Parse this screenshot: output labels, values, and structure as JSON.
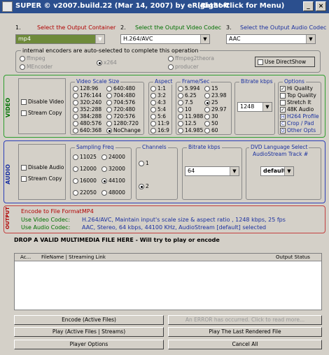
{
  "window": {
    "title": "SUPER © v2007.build.22 (Mar 14, 2007) by eRightSoft",
    "context_hint": "(Right-Click for Menu)",
    "minimize_glyph": "_",
    "close_glyph": "×"
  },
  "steps": {
    "s1_num": "1.",
    "s1_label": "Select the Output Container",
    "s2_num": "2.",
    "s2_label": "Select the Output Video Codec",
    "s3_num": "3.",
    "s3_label": "Select the Output Audio Codec"
  },
  "selects": {
    "container": "mp4",
    "video_codec": "H.264/AVC",
    "audio_codec": "AAC"
  },
  "encoders": {
    "label": "internal encoders are auto-selected to complete this operation",
    "items": [
      "ffmpeg",
      "x264",
      "ffmpeg2theora",
      "MEncoder",
      "producer"
    ],
    "use_directshow": "Use DirectShow"
  },
  "video": {
    "section": "VIDEO",
    "disable": "Disable Video",
    "stream_copy": "Stream Copy",
    "scale_title": "Video Scale Size",
    "scale_col1": [
      "128:96",
      "176:144",
      "320:240",
      "352:288",
      "384:288",
      "480:576",
      "640:368"
    ],
    "scale_col2": [
      "640:480",
      "704:480",
      "704:576",
      "720:480",
      "720:576",
      "1280:720",
      "NoChange"
    ],
    "aspect_title": "Aspect",
    "aspect": [
      "1:1",
      "3:2",
      "4:3",
      "5:4",
      "5:6",
      "11:9",
      "16:9"
    ],
    "fps_title": "Frame/Sec",
    "fps_col1": [
      "5.994",
      "6.25",
      "7.5",
      "10",
      "11.988",
      "12.5",
      "14.985"
    ],
    "fps_col2": [
      "15",
      "23.98",
      "25",
      "29.97",
      "30",
      "50",
      "60"
    ],
    "bitrate_title": "Bitrate  kbps",
    "bitrate": "1248",
    "options_title": "Options",
    "options": [
      "Hi Quality",
      "Top Quality",
      "Stretch It",
      "48K Audio"
    ],
    "h264_profile": "H264 Profile",
    "crop_pad": "Crop / Pad",
    "other_opts": "Other Opts",
    "h_icon": "H",
    "c_icon": "C",
    "o_icon": "O"
  },
  "audio": {
    "section": "AUDIO",
    "disable": "Disable Audio",
    "stream_copy": "Stream Copy",
    "freq_title": "Sampling Freq",
    "freq_col1": [
      "11025",
      "12000",
      "16000",
      "22050"
    ],
    "freq_col2": [
      "24000",
      "32000",
      "44100",
      "48000"
    ],
    "channels_title": "Channels",
    "channels": [
      "1",
      "2"
    ],
    "bitrate_title": "Bitrate  kbps",
    "bitrate": "64",
    "dvd_title": "DVD Language Select",
    "dvd_sub": "AudioStream  Track #",
    "dvd_value": "default"
  },
  "output": {
    "section": "OUTPUT",
    "format_label": "Encode to File Format:",
    "format_value": "MP4",
    "video_label": "Use Video Codec:",
    "video_value": "H.264/AVC,  Maintain input's scale size & aspect ratio ,  1248 kbps,  25 fps",
    "audio_label": "Use Audio Codec:",
    "audio_value": "AAC,  Stereo,  64 kbps,  44100 KHz,  AudioStream [default] selected"
  },
  "drop_hint": "DROP A VALID MULTIMEDIA FILE HERE - Will try to play or encode",
  "table": {
    "col_active": "Ac...",
    "col_file": "FileName  |  Streaming Link",
    "col_status": "Output Status"
  },
  "buttons": {
    "encode": "Encode (Active Files)",
    "error": "An ERROR has occurred. Click to read more...",
    "play": "Play (Active Files | Streams)",
    "play_last": "Play The Last Rendered File",
    "player_options": "Player Options",
    "cancel": "Cancel All"
  },
  "colors": {
    "title_bar": "#2b4f8e",
    "accent_red": "#b00000",
    "accent_blue": "#1a30a0",
    "accent_green": "#007000"
  }
}
